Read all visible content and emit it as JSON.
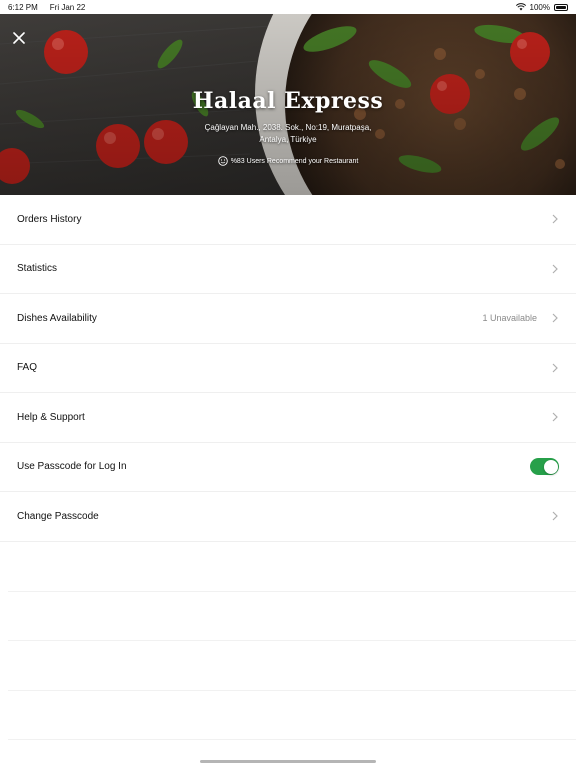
{
  "status_bar": {
    "time": "6:12 PM",
    "date": "Fri Jan 22",
    "battery": "100%"
  },
  "hero": {
    "title": "Halaal Express",
    "address_line1": "Çağlayan Mah., 2038. Sok., No:19, Muratpaşa,",
    "address_line2": "Antalya, Türkiye",
    "recommend_text": "%83 Users Recommend your Restaurant"
  },
  "menu": {
    "items": [
      {
        "label": "Orders History",
        "value": "",
        "type": "nav"
      },
      {
        "label": "Statistics",
        "value": "",
        "type": "nav"
      },
      {
        "label": "Dishes Availability",
        "value": "1 Unavailable",
        "type": "nav"
      },
      {
        "label": "FAQ",
        "value": "",
        "type": "nav"
      },
      {
        "label": "Help & Support",
        "value": "",
        "type": "nav"
      },
      {
        "label": "Use Passcode for Log In",
        "value": "",
        "type": "toggle",
        "toggle_on": true
      },
      {
        "label": "Change Passcode",
        "value": "",
        "type": "nav"
      }
    ]
  },
  "colors": {
    "toggle_on": "#27a04a",
    "chevron": "#b0b0b0"
  }
}
